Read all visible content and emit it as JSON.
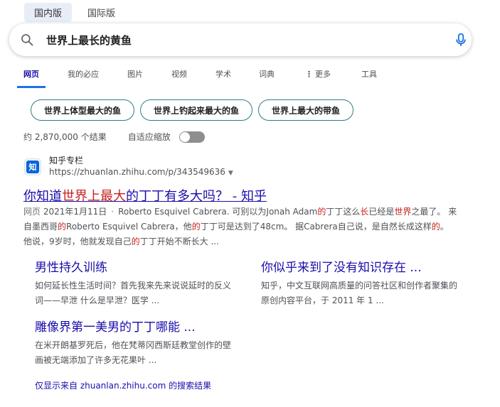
{
  "region_tabs": [
    "国内版",
    "国际版"
  ],
  "search": {
    "query": "世界上最长的黄鱼"
  },
  "nav": {
    "items": [
      "网页",
      "我的必应",
      "图片",
      "视频",
      "学术",
      "词典",
      "更多",
      "工具"
    ]
  },
  "chips": [
    "世界上体型最大的鱼",
    "世界上钓起来最大的鱼",
    "世界上最大的带鱼"
  ],
  "stats": {
    "count": "约 2,870,000 个结果",
    "autozoom": "自适应缩放"
  },
  "result": {
    "favicon_glyph": "知",
    "site_name": "知乎专栏",
    "url": "https://zhuanlan.zhihu.com/p/343549636",
    "title_parts": [
      "你知道",
      "世界上最大",
      "的丁丁有多大吗？ - 知乎"
    ],
    "snippet_tag": "网页",
    "snippet_date": "2021年1月11日",
    "snippet_parts": [
      "Roberto Esquivel Cabrera. 可别以为Jonah Adam",
      "的",
      "丁丁这么",
      "长",
      "已经是",
      "世界",
      "之最了。 来自墨西哥",
      "的",
      "Roberto Esquivel Cabrera，他",
      "的",
      "丁丁可是达到了48cm。 据Cabrera自己说，是自然长成这样",
      "的",
      "。 他说，9岁时，他就发现自己",
      "的",
      "丁丁开始不断长大 ..."
    ]
  },
  "sublinks": [
    {
      "title": "男性持久训练",
      "desc": "如何延长性生活时间？首先我来先来说说延时的反义词——早泄 什么是早泄？医学 ..."
    },
    {
      "title": "你似乎来到了没有知识存在 ...",
      "desc": "知乎，中文互联网高质量的问答社区和创作者聚集的原创内容平台，于 2011 年 1 ..."
    },
    {
      "title": "雕像界第一美男的丁丁哪能 ...",
      "desc": "在米开朗基罗死后，他在梵蒂冈西斯廷教堂创作的壁画被无端添加了许多无花果叶 ..."
    }
  ],
  "only_from": "仅显示来自 zhuanlan.zhihu.com 的搜索结果",
  "colors": {
    "link": "#1a0dab",
    "highlight": "#c5221f",
    "accent": "#1a73e8",
    "chip_border": "#2e7d86"
  }
}
